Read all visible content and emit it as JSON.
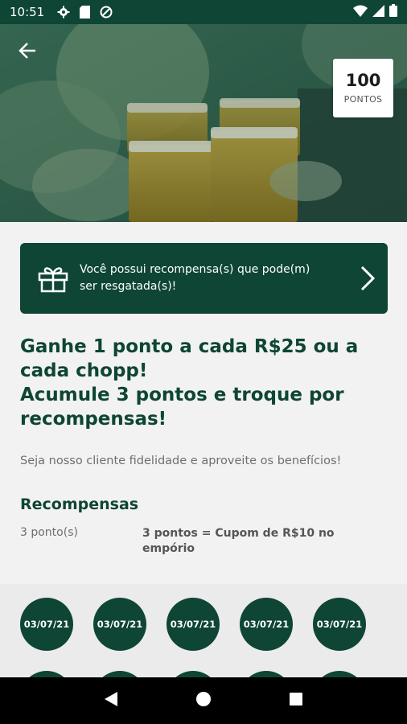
{
  "status_bar": {
    "time": "10:51",
    "icons": [
      "gear-icon",
      "sd-card-icon",
      "vpn-icon",
      "wifi-icon",
      "signal-icon",
      "battery-icon"
    ]
  },
  "header": {
    "back_icon": "arrow-left-icon",
    "points_value": "100",
    "points_label": "PONTOS"
  },
  "reward_banner": {
    "icon": "gift-icon",
    "line1": "Você possui recompensa(s) que pode(m)",
    "line2": "ser resgatada(s)!",
    "chevron_icon": "chevron-right-icon"
  },
  "headline": {
    "line1": "Ganhe 1 ponto a cada R$25 ou a",
    "line2": "cada chopp!",
    "line3": "Acumule 3 pontos e troque por",
    "line4": "recompensas!"
  },
  "subtitle": "Seja nosso cliente fidelidade e aproveite os benefícios!",
  "rewards": {
    "title": "Recompensas",
    "items": [
      {
        "points": "3 ponto(s)",
        "description_line1": "3 pontos = Cupom de R$10 no",
        "description_line2": "empório"
      }
    ]
  },
  "stamps": {
    "row1": [
      "03/07/21",
      "03/07/21",
      "03/07/21",
      "03/07/21",
      "03/07/21"
    ]
  },
  "colors": {
    "brand": "#0e4535",
    "background": "#f2f2f2",
    "text_muted": "#6f6f6f"
  },
  "nav_bar": {
    "icons": [
      "back-triangle-icon",
      "home-circle-icon",
      "recents-square-icon"
    ]
  }
}
